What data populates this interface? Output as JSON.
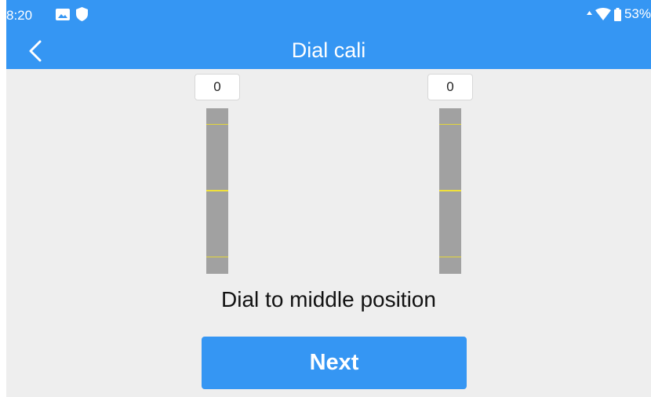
{
  "status_bar": {
    "time": "8:20",
    "battery": "53%",
    "icons": [
      "image-icon",
      "shield-icon",
      "signal-arrow-icon",
      "wifi-icon",
      "battery-icon"
    ]
  },
  "header": {
    "title": "Dial cali",
    "back_icon": "chevron-left-icon"
  },
  "dials": [
    {
      "value": "0",
      "level": 0.5
    },
    {
      "value": "0",
      "level": 0.5
    }
  ],
  "instruction": "Dial to middle position",
  "next_button": {
    "label": "Next"
  },
  "colors": {
    "accent": "#3596f3",
    "background": "#eeeeee",
    "track": "#a1a1a1",
    "tick": "#f0e13a"
  }
}
